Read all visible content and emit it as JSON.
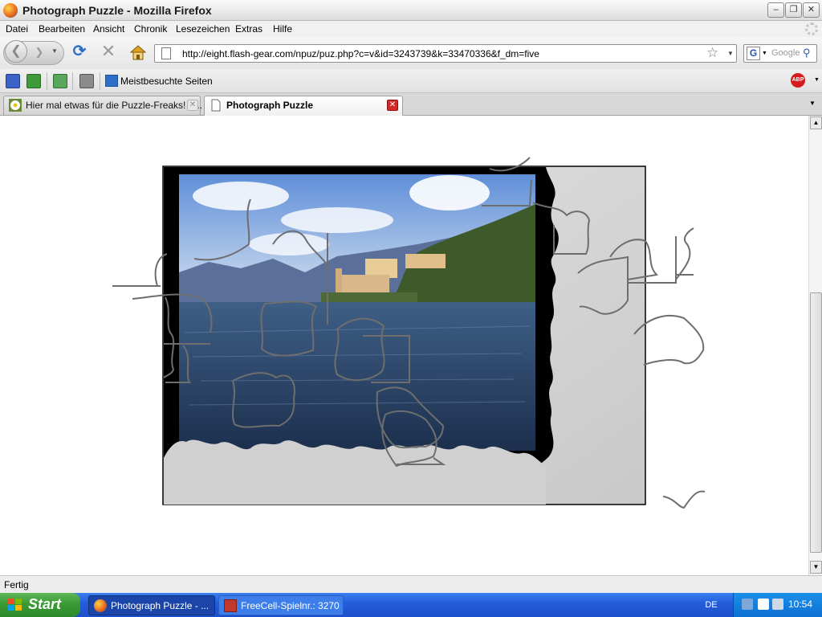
{
  "window": {
    "title": "Photograph Puzzle - Mozilla Firefox"
  },
  "menu": [
    "Datei",
    "Bearbeiten",
    "Ansicht",
    "Chronik",
    "Lesezeichen",
    "Extras",
    "Hilfe"
  ],
  "nav": {
    "url": "http://eight.flash-gear.com/npuz/puz.php?c=v&id=3243739&k=33470336&f_dm=five",
    "search_placeholder": "Google"
  },
  "bookmarks": {
    "meistbesucht": "Meistbesuchte Seiten",
    "abp": "ABP"
  },
  "tabs": [
    {
      "label": "Hier mal etwas für die Puzzle-Freaks! - ...",
      "active": false
    },
    {
      "label": "Photograph Puzzle",
      "active": true
    }
  ],
  "status": {
    "text": "Fertig"
  },
  "taskbar": {
    "start": "Start",
    "tasks": [
      {
        "label": "Photograph Puzzle - ...",
        "active": true
      },
      {
        "label": "FreeCell-Spielnr.: 3270",
        "active": false
      }
    ],
    "language": "DE",
    "clock": "10:54"
  },
  "colors": {
    "puzzle_board_bg": "#d7d7d7",
    "puzzle_frame": "#000000",
    "piece_outline": "#6e6e6e",
    "taskbar_blue": "#245edb",
    "start_green": "#3a9a35"
  }
}
